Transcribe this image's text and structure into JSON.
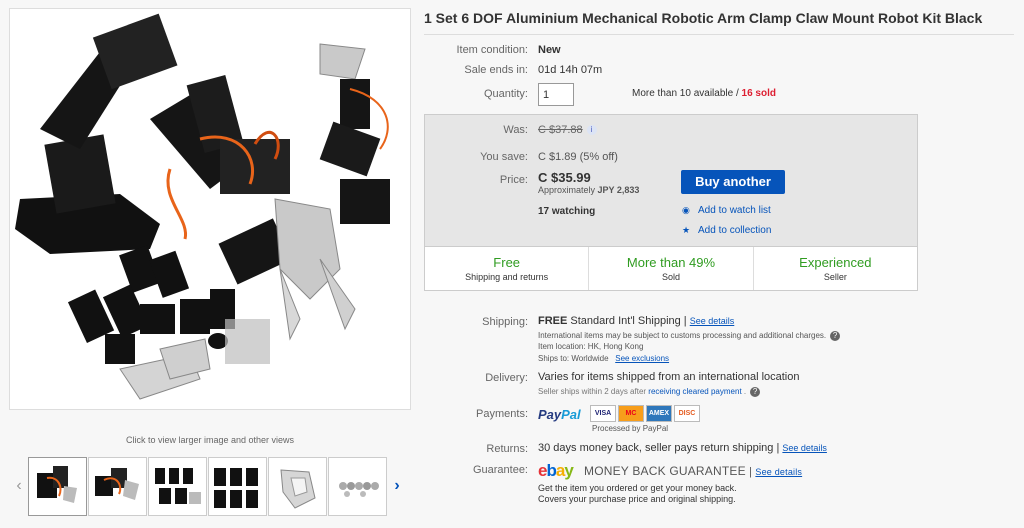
{
  "title": "1 Set 6 DOF Aluminium Mechanical Robotic Arm Clamp Claw Mount Robot Kit Black",
  "gallery": {
    "caption": "Click to view larger image and other views"
  },
  "item": {
    "condition_label": "Item condition:",
    "condition_value": "New",
    "sale_label": "Sale ends in:",
    "sale_value": "01d 14h 07m",
    "quantity_label": "Quantity:",
    "quantity_value": "1",
    "availability": "More than 10 available / ",
    "sold": "16 sold"
  },
  "pricing": {
    "was_label": "Was:",
    "was_value": "C $37.88",
    "save_label": "You save:",
    "save_value": "C $1.89 (5% off)",
    "price_label": "Price:",
    "price_value": "C $35.99",
    "approx_text": "Approximately ",
    "approx_value": "JPY 2,833",
    "watching": "17 watching",
    "buy_label": "Buy another",
    "watch_label": "Add to watch list",
    "collection_label": "Add to collection"
  },
  "stats": [
    {
      "big": "Free",
      "small": "Shipping and returns"
    },
    {
      "big": "More than 49%",
      "small": "Sold"
    },
    {
      "big": "Experienced",
      "small": "Seller"
    }
  ],
  "shipping": {
    "label": "Shipping:",
    "free": "FREE",
    "method": "  Standard Int'l Shipping",
    "sep": " | ",
    "details": "See details",
    "note": "International items may be subject to customs processing and additional charges.",
    "location": "Item location:  HK, Hong Kong",
    "ships_to": "Ships to:  Worldwide",
    "exclusions": "See exclusions"
  },
  "delivery": {
    "label": "Delivery:",
    "value": "Varies for items shipped from an international location",
    "note": "Seller ships within 2 days after ",
    "note_link": "receiving cleared payment",
    "note_end": " ."
  },
  "payments": {
    "label": "Payments:",
    "paypal_1": "Pay",
    "paypal_2": "Pal",
    "cards": [
      "VISA",
      "MC",
      "AMEX",
      "DISC"
    ],
    "processed": "Processed by PayPal"
  },
  "returns": {
    "label": "Returns:",
    "value": "30 days money back, seller pays return shipping",
    "sep": " | ",
    "details": "See details"
  },
  "guarantee": {
    "label": "Guarantee:",
    "logo_e": "e",
    "logo_b": "b",
    "logo_a": "a",
    "logo_y": "y",
    "mbg": "MONEY BACK GUARANTEE",
    "sep": "  |  ",
    "details": "See details",
    "line1": "Get the item you ordered or get your money back.",
    "line2": "Covers your purchase price and original shipping."
  },
  "colors": {
    "link": "#0654ba",
    "sold": "#dd1e31",
    "stat_green": "#309c21",
    "button": "#0654ba"
  }
}
